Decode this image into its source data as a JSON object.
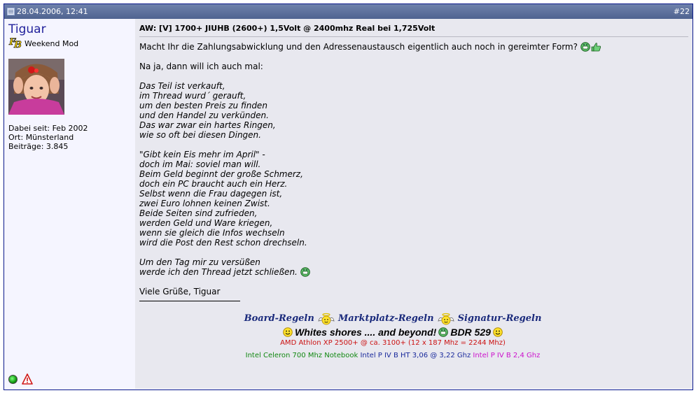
{
  "header": {
    "timestamp": "28.04.2006, 12:41",
    "post_number": "#22"
  },
  "user": {
    "name": "Tiguar",
    "title": "Weekend Mod",
    "joined": "Dabei seit: Feb 2002",
    "location": "Ort: Münsterland",
    "posts": "Beiträge: 3.845"
  },
  "post": {
    "title": "AW: [V] 1700+ JIUHB (2600+) 1,5Volt @ 2400mhz Real bei 1,725Volt",
    "intro": "Macht Ihr die Zahlungsabwicklung und den Adressenaustausch eigentlich auch noch in gereimter Form?",
    "line2": "Na ja, dann will ich auch mal:",
    "stanza1": [
      "Das Teil ist verkauft,",
      "im Thread wurd´ gerauft,",
      "um den besten Preis zu finden",
      "und den Handel zu verkünden.",
      "Das war zwar ein hartes Ringen,",
      "wie so oft bei diesen Dingen."
    ],
    "stanza2": [
      "\"Gibt kein Eis mehr im April\" -",
      "doch im Mai: soviel man will.",
      "Beim Geld beginnt der große Schmerz,",
      "doch ein PC braucht auch ein Herz.",
      "Selbst wenn die Frau dagegen ist,",
      "zwei Euro lohnen keinen Zwist.",
      "Beide Seiten sind zufrieden,",
      "werden Geld und Ware kriegen,",
      "wenn sie gleich die Infos wechseln",
      "wird die Post den Rest schon drechseln."
    ],
    "stanza3": [
      "Um den Tag mir zu versüßen",
      "werde ich den Thread jetzt schließen."
    ],
    "closing": "Viele Grüße, Tiguar"
  },
  "signature": {
    "board_rules": "Board-Regeln",
    "market_rules": "Marktplatz-Regeln",
    "sig_rules": "Signatur-Regeln",
    "motto": "Whites shores .... and beyond!",
    "bdr": "BDR 529",
    "amd": "AMD Athlon XP 2500+ @ ca. 3100+ (12 x 187 Mhz = 2244 Mhz)",
    "celeron": "Intel Celeron 700 Mhz Notebook",
    "p4ht": "Intel P IV B HT 3,06 @ 3,22 Ghz",
    "p4b": "Intel P IV B 2,4 Ghz"
  },
  "colors": {
    "header": "#5c7099",
    "left_bg": "#f5f5ff",
    "right_bg": "#e8e8ef",
    "username": "#22229c",
    "amd": "#cc1111",
    "celeron": "#118811",
    "p4ht": "#1a2a9c",
    "p4b": "#cc11cc"
  }
}
